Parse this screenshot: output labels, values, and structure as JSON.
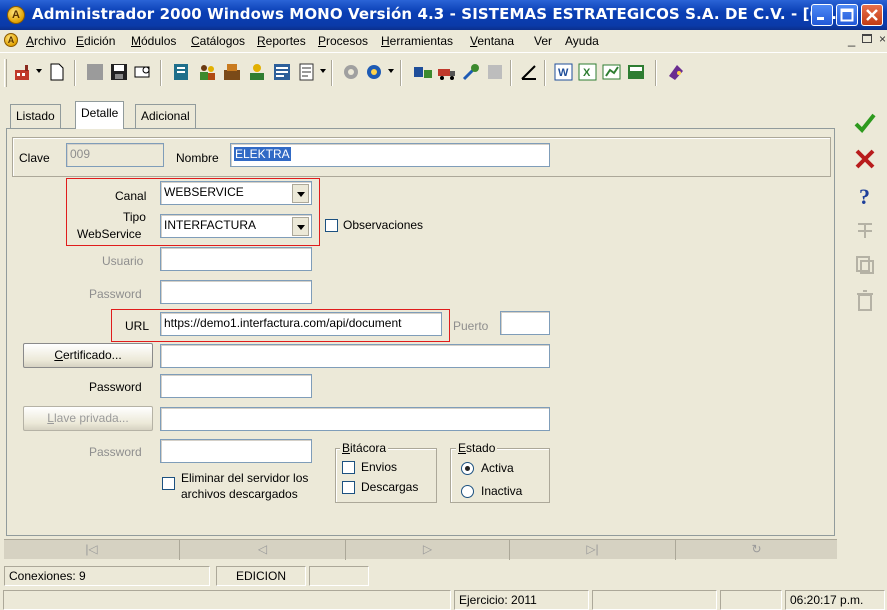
{
  "window": {
    "title": "Administrador 2000 Windows MONO Versión 4.3 - SISTEMAS ESTRATEGICOS S.A. DE C.V. - [Co...",
    "app_icon_letter": "A",
    "mdi_icon_letter": "A"
  },
  "menu": [
    {
      "label": "Archivo",
      "u": "A",
      "rest": "rchivo"
    },
    {
      "label": "Edición",
      "u": "E",
      "rest": "dición"
    },
    {
      "label": "Módulos",
      "u": "M",
      "rest": "ódulos"
    },
    {
      "label": "Catálogos",
      "u": "C",
      "rest": "atálogos"
    },
    {
      "label": "Reportes",
      "u": "R",
      "rest": "eportes"
    },
    {
      "label": "Procesos",
      "u": "P",
      "rest": "rocesos"
    },
    {
      "label": "Herramientas",
      "u": "H",
      "rest": "erramientas"
    },
    {
      "label": "Ventana",
      "u": "V",
      "rest": "entana"
    },
    {
      "label": "Ver",
      "u": "",
      "rest": "Ver"
    },
    {
      "label": "Ayuda",
      "u": "",
      "rest": "Ayuda"
    }
  ],
  "tabs": [
    "Listado",
    "Detalle",
    "Adicional"
  ],
  "form": {
    "clave_label": "Clave",
    "clave_value": "009",
    "nombre_label": "Nombre",
    "nombre_value": "ELEKTRA",
    "canal_label": "Canal",
    "canal_value": "WEBSERVICE",
    "tipo_label_1": "Tipo",
    "tipo_label_2": "WebService",
    "tipo_value": "INTERFACTURA",
    "observaciones_label": "Observaciones",
    "usuario_label": "Usuario",
    "password_label": "Password",
    "url_label": "URL",
    "url_value": "https://demo1.interfactura.com/api/document",
    "puerto_label": "Puerto",
    "certificado_button": "Certificado...",
    "certificado_u": "C",
    "certificado_rest": "ertificado...",
    "password2_label": "Password",
    "llave_button": "Llave privada...",
    "llave_u": "L",
    "llave_rest": "lave privada...",
    "password3_label": "Password",
    "eliminar_line1": "Eliminar del servidor los",
    "eliminar_line2": "archivos descargados",
    "bitacora_title": "Bitácora",
    "bitacora_u": "B",
    "bitacora_rest": "itácora",
    "envios_label": "Envios",
    "descargas_label": "Descargas",
    "estado_title": "Estado",
    "estado_u": "E",
    "estado_rest": "stado",
    "activa_label": "Activa",
    "inactiva_label": "Inactiva",
    "estado_selected": "Activa"
  },
  "status": {
    "conexiones": "Conexiones: 9",
    "modo": "EDICION",
    "ejercicio": "Ejercicio: 2011",
    "hora": "06:20:17 p.m."
  },
  "colors": {
    "highlight": "#e01c1c",
    "selection": "#316ac5",
    "titlebar": "#0a3fb5"
  },
  "right_actions": [
    "check-icon",
    "cancel-icon",
    "help-icon",
    "disabled-action-icon",
    "disabled-copy-icon",
    "delete-icon"
  ]
}
